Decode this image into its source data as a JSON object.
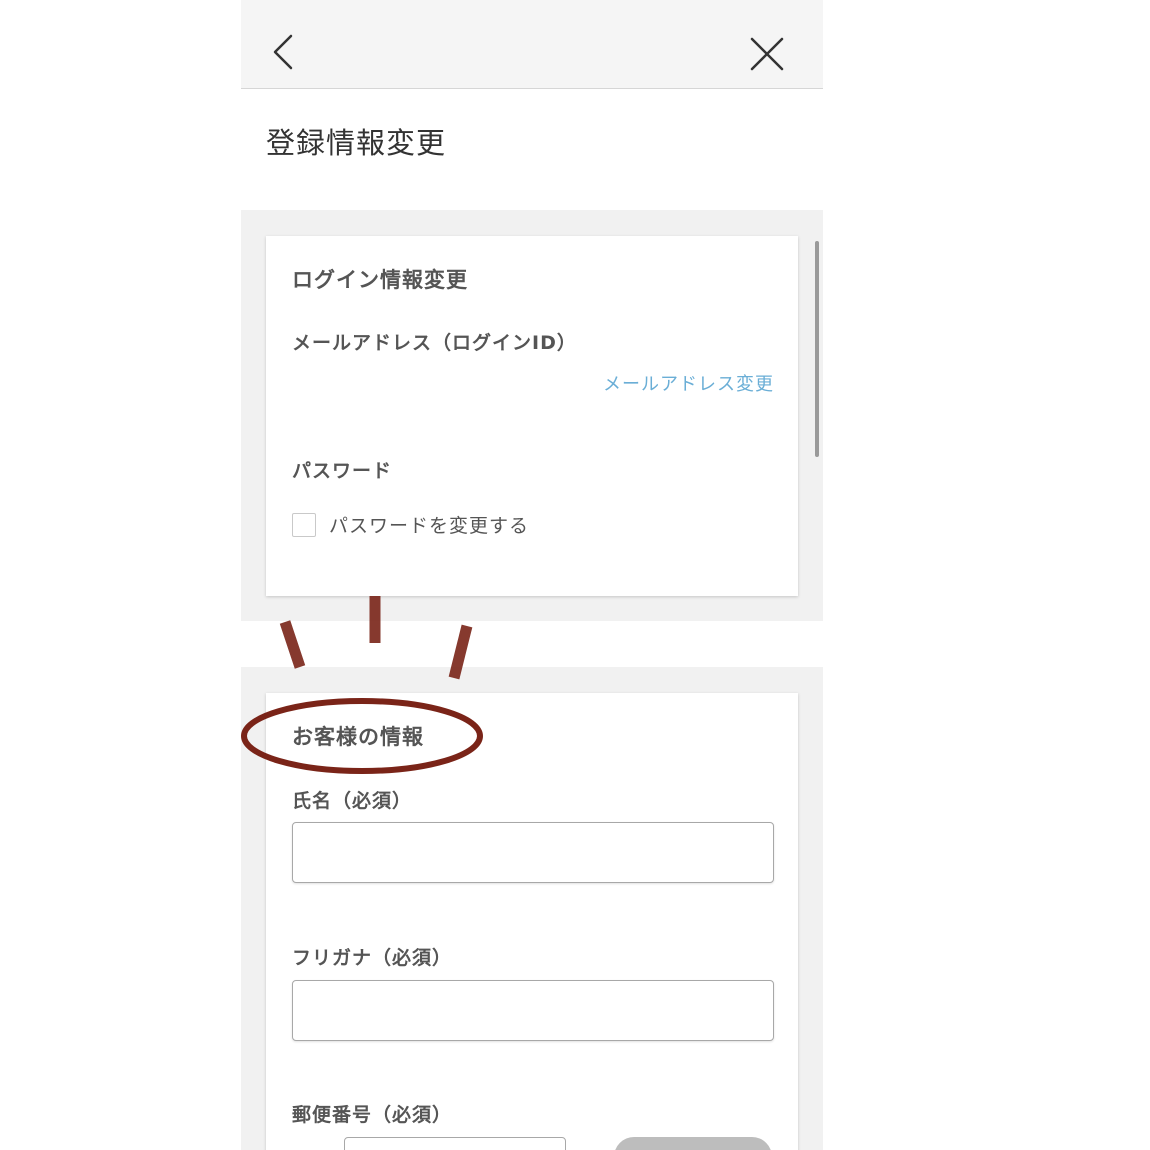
{
  "header": {
    "back_icon": "chevron-left-icon",
    "close_icon": "close-icon"
  },
  "page": {
    "title": "登録情報変更"
  },
  "login_section": {
    "title": "ログイン情報変更",
    "email_label": "メールアドレス（ログインID）",
    "email_change_link": "メールアドレス変更",
    "password_label": "パスワード",
    "change_password_checkbox_label": "パスワードを変更する",
    "change_password_checked": false
  },
  "customer_section": {
    "title": "お客様の情報",
    "name_label": "氏名（必須）",
    "name_value": "",
    "furigana_label": "フリガナ（必須）",
    "furigana_value": "",
    "postal_label": "郵便番号（必須）",
    "postal_value": ""
  },
  "colors": {
    "link": "#6aaed6",
    "annotation": "#7a2418",
    "header_bg": "#f5f5f5",
    "band_bg": "#f1f1f1"
  }
}
